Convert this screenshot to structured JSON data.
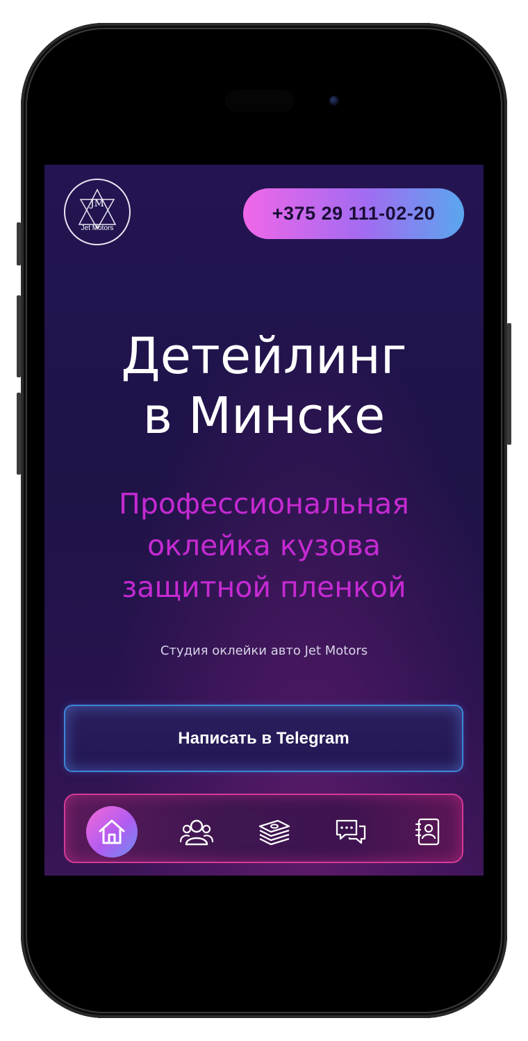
{
  "header": {
    "logo_monogram": "JM",
    "logo_name": "Jet Motors",
    "phone": "+375 29 111-02-20"
  },
  "hero": {
    "title_lines": [
      "Детейлинг",
      "в Минске"
    ],
    "subtitle_lines": [
      "Профессиональная",
      "оклейка кузова",
      "защитной пленкой"
    ],
    "caption": "Студия оклейки авто Jet Motors"
  },
  "cta": {
    "telegram_label": "Написать в Telegram"
  },
  "bottom_nav": {
    "items": [
      {
        "icon": "home-icon",
        "active": true
      },
      {
        "icon": "users-icon",
        "active": false
      },
      {
        "icon": "money-stack-icon",
        "active": false
      },
      {
        "icon": "chat-icon",
        "active": false
      },
      {
        "icon": "contacts-book-icon",
        "active": false
      }
    ]
  },
  "colors": {
    "background": "#211450",
    "subtitle": "#c52ad2",
    "phone_gradient": [
      "#f067e8",
      "#a26bf1",
      "#5aa6ee"
    ],
    "telegram_border": "#3d86d8",
    "nav_border": "#d43a96"
  }
}
